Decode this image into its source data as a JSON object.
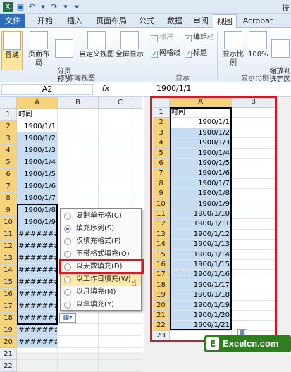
{
  "titlebar": {
    "title": "技"
  },
  "tabs": [
    "文件",
    "开始",
    "插入",
    "页面布局",
    "公式",
    "数据",
    "审阅",
    "视图",
    "Acrobat"
  ],
  "ribbon": {
    "buttons": [
      "普通",
      "页面布局",
      "分页\n预览",
      "自定义视图",
      "全屏显示",
      "显示比例",
      "100%",
      "缩放到\n选定区"
    ],
    "checks": [
      {
        "label": "标尺",
        "checked": true,
        "disabled": true
      },
      {
        "label": "编辑栏",
        "checked": true,
        "disabled": false
      },
      {
        "label": "网格线",
        "checked": true,
        "disabled": false
      },
      {
        "label": "标题",
        "checked": true,
        "disabled": false
      }
    ],
    "groups": [
      "工作簿视图",
      "显示",
      "显示比例"
    ]
  },
  "formula": {
    "namebox": "A2",
    "fx": "fx",
    "value": "1900/1/1"
  },
  "left_sheet": {
    "columns": [
      "A",
      "B",
      "C"
    ],
    "rows": [
      "1",
      "2",
      "3",
      "4",
      "5",
      "6",
      "7",
      "8",
      "9",
      "10",
      "11",
      "12",
      "13",
      "14",
      "15",
      "16",
      "17",
      "18",
      "19",
      "20",
      "21",
      "22"
    ],
    "header_cell": "时间",
    "values": [
      "1900/1/1",
      "1900/1/2",
      "1900/1/3",
      "1900/1/4",
      "1900/1/5",
      "1900/1/6",
      "1900/1/7",
      "1900/1/8",
      "1900/1/9",
      "########",
      "########",
      "########",
      "########",
      "########",
      "########",
      "########",
      "########",
      "########",
      "########"
    ]
  },
  "right_sheet": {
    "columns": [
      "A",
      "B"
    ],
    "rows": [
      "1",
      "2",
      "3",
      "4",
      "5",
      "6",
      "7",
      "8",
      "9",
      "10",
      "11",
      "12",
      "13",
      "14",
      "15",
      "16",
      "17",
      "18",
      "19",
      "20",
      "21",
      "22",
      "23"
    ],
    "header_cell": "时间",
    "values": [
      "1900/1/1",
      "1900/1/2",
      "1900/1/3",
      "1900/1/4",
      "1900/1/5",
      "1900/1/6",
      "1900/1/7",
      "1900/1/8",
      "1900/1/9",
      "1900/1/10",
      "1900/1/11",
      "1900/1/12",
      "1900/1/13",
      "1900/1/14",
      "1900/1/15",
      "1900/1/16",
      "1900/1/17",
      "1900/1/18",
      "1900/1/19",
      "1900/1/20",
      "1900/1/21"
    ]
  },
  "menu": {
    "items": [
      "复制单元格(C)",
      "填充序列(S)",
      "仅填充格式(F)",
      "不带格式填充(O)",
      "以天数填充(D)",
      "以工作日填充(W)",
      "以月填充(M)",
      "以年填充(Y)"
    ],
    "selected_index": 1,
    "hover_index": 5
  },
  "watermark": "Excelcn.com",
  "colors": {
    "accent": "#e0141a",
    "selection": "#c5dcf2",
    "tab_file": "#2a6ebb"
  }
}
